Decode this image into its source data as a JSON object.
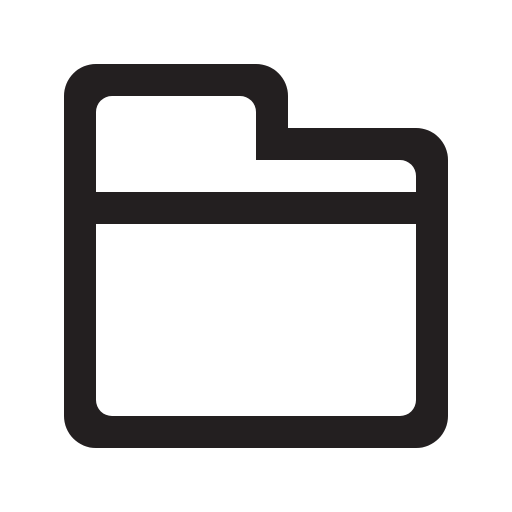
{
  "icon": {
    "name": "folder-icon",
    "stroke_color": "#231f20",
    "fill_color": "#ffffff"
  },
  "background_color": "#ffffff"
}
